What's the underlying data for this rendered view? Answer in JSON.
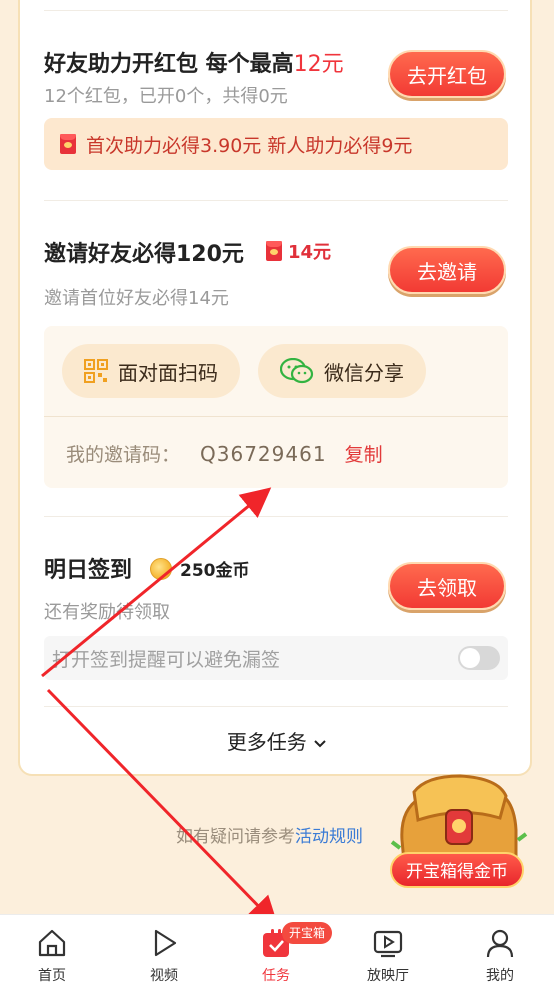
{
  "task_redpacket": {
    "title": "好友助力开红包 每个最高",
    "title_highlight": "12元",
    "subtitle": "12个红包，已开0个，共得0元",
    "button_label": "去开红包",
    "promo_text": "首次助力必得3.90元 新人助力必得9元"
  },
  "task_invite": {
    "title": "邀请好友必得120元",
    "bonus": "14元",
    "subtitle": "邀请首位好友必得14元",
    "button_label": "去邀请",
    "share_options": [
      {
        "label": "面对面扫码",
        "icon": "qr-code-icon"
      },
      {
        "label": "微信分享",
        "icon": "wechat-icon"
      }
    ],
    "invite_code_label": "我的邀请码：",
    "invite_code": "Q36729461",
    "copy_label": "复制"
  },
  "task_checkin": {
    "title": "明日签到",
    "reward": "250金币",
    "subtitle": "还有奖励待领取",
    "button_label": "去领取",
    "reminder_text": "打开签到提醒可以避免漏签",
    "reminder_enabled": false
  },
  "more_tasks_label": "更多任务",
  "faq": {
    "prefix": "如有疑问请参考",
    "link": "活动规则"
  },
  "treasure_chest_label": "开宝箱得金币",
  "tab_badge": "开宝箱",
  "tabs": [
    {
      "label": "首页",
      "icon": "home-icon",
      "active": false
    },
    {
      "label": "视频",
      "icon": "play-icon",
      "active": false
    },
    {
      "label": "任务",
      "icon": "task-icon",
      "active": true
    },
    {
      "label": "放映厅",
      "icon": "theater-icon",
      "active": false
    },
    {
      "label": "我的",
      "icon": "profile-icon",
      "active": false
    }
  ],
  "colors": {
    "accent_red": "#f0353c",
    "background": "#fcefdc",
    "link_blue": "#3a7bd5",
    "annotation_arrow": "#f0252a"
  }
}
